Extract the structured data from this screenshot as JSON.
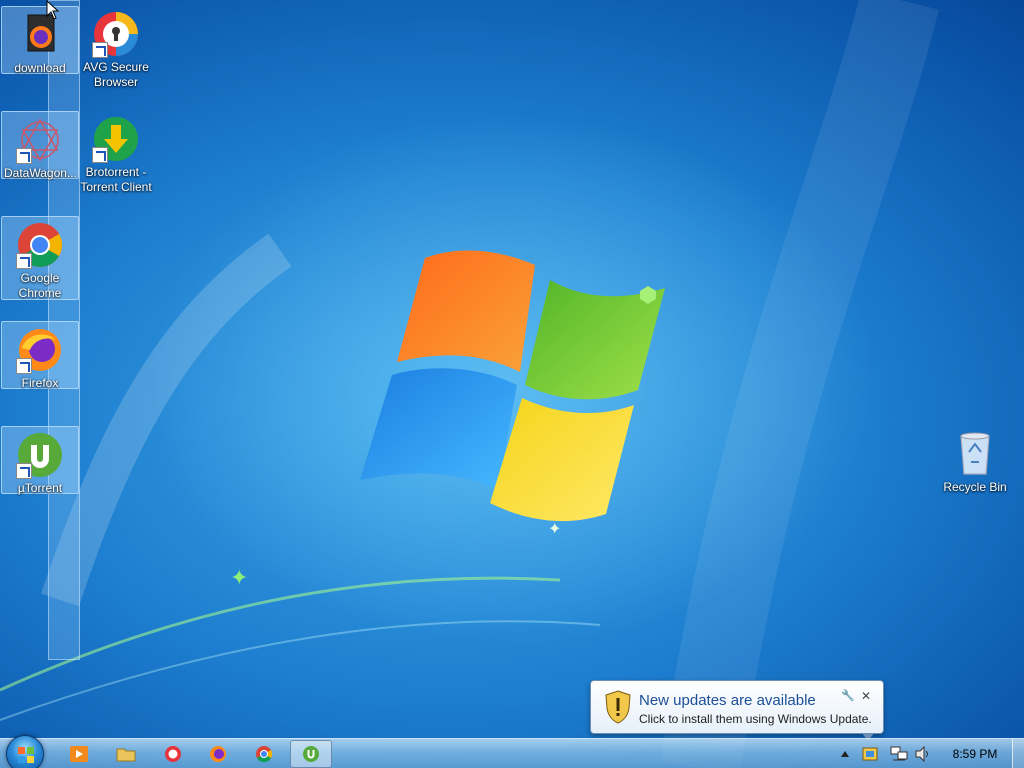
{
  "desktop": {
    "icons": [
      {
        "id": "download",
        "label": "download",
        "icon": "firefox-document-icon",
        "shortcut": false
      },
      {
        "id": "avg",
        "label": "AVG Secure Browser",
        "icon": "avg-secure-browser-icon",
        "shortcut": true
      },
      {
        "id": "datawagon",
        "label": "DataWagon...",
        "icon": "datawagon-icon",
        "shortcut": true
      },
      {
        "id": "brotorrent",
        "label": "Brotorrent - Torrent Client",
        "icon": "brotorrent-icon",
        "shortcut": true
      },
      {
        "id": "chrome",
        "label": "Google Chrome",
        "icon": "chrome-icon",
        "shortcut": true
      },
      {
        "id": "firefox",
        "label": "Firefox",
        "icon": "firefox-icon",
        "shortcut": true
      },
      {
        "id": "utorrent",
        "label": "µTorrent",
        "icon": "utorrent-icon",
        "shortcut": true
      },
      {
        "id": "recycle",
        "label": "Recycle Bin",
        "icon": "recycle-bin-icon",
        "shortcut": false
      }
    ]
  },
  "notification": {
    "title": "New updates are available",
    "body": "Click to install them using Windows Update.",
    "icon": "windows-update-shield-icon",
    "close_glyph": "✕",
    "options_glyph": "🔧"
  },
  "taskbar": {
    "start": "start-orb-icon",
    "pinned": [
      {
        "id": "media-player",
        "icon": "media-player-icon",
        "active": false
      },
      {
        "id": "explorer",
        "icon": "folder-icon",
        "active": false
      },
      {
        "id": "avg",
        "icon": "avg-secure-browser-icon",
        "active": false
      },
      {
        "id": "firefox",
        "icon": "firefox-icon",
        "active": false
      },
      {
        "id": "chrome",
        "icon": "chrome-icon",
        "active": false
      },
      {
        "id": "utorrent",
        "icon": "utorrent-icon",
        "active": true
      }
    ],
    "tray": {
      "icons": [
        "show-hidden-icons-arrow",
        "windows-update-flag-icon",
        "network-icon",
        "volume-icon"
      ],
      "clock": "8:59 PM"
    }
  },
  "colors": {
    "notification_title": "#1c4f96",
    "desktop_background": "#1e7fd0"
  }
}
